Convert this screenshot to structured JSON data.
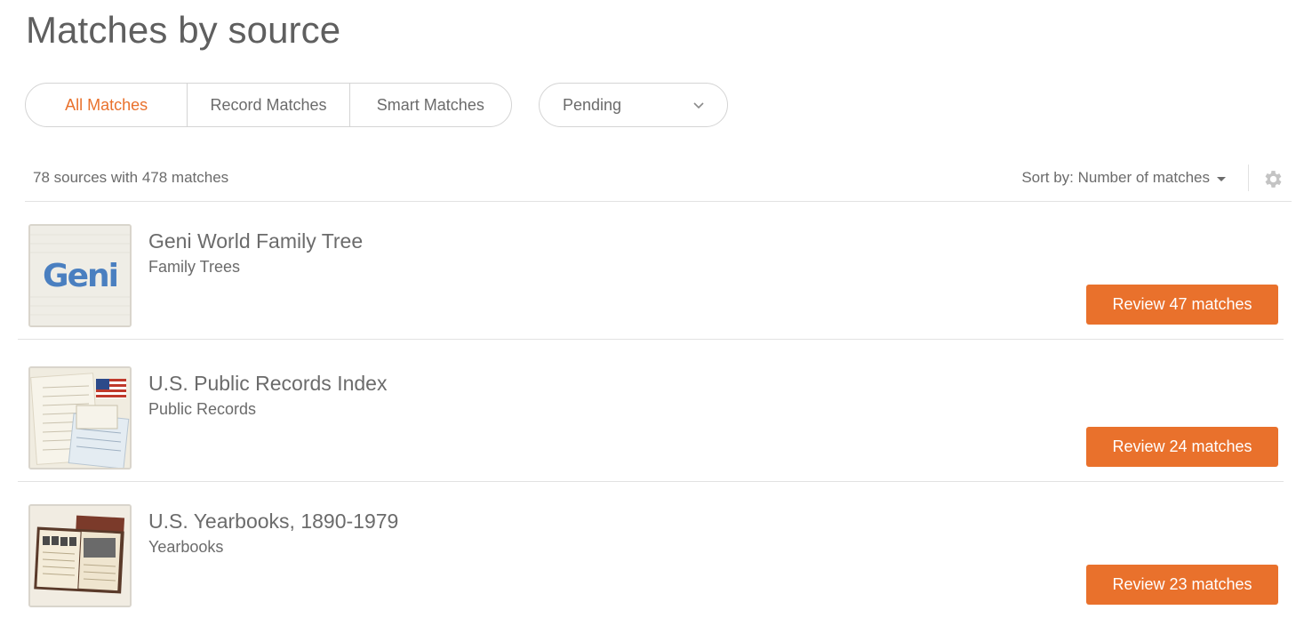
{
  "page_title": "Matches by source",
  "filters": {
    "tabs": [
      {
        "label": "All Matches",
        "active": true
      },
      {
        "label": "Record Matches",
        "active": false
      },
      {
        "label": "Smart Matches",
        "active": false
      }
    ],
    "status": "Pending"
  },
  "summary": "78 sources with 478 matches",
  "sort": {
    "label": "Sort by:",
    "value": "Number of matches"
  },
  "icons": {
    "settings": "gear-icon",
    "status_dropdown": "chevron-down-icon",
    "sort_dropdown": "caret-down-icon"
  },
  "colors": {
    "accent": "#e9712c",
    "text": "#6b6b6b",
    "divider": "#e2e2e2"
  },
  "sources": [
    {
      "title": "Geni World Family Tree",
      "category": "Family Trees",
      "button": "Review 47 matches",
      "logo_text": "Geni"
    },
    {
      "title": "U.S. Public Records Index",
      "category": "Public Records",
      "button": "Review 24 matches"
    },
    {
      "title": "U.S. Yearbooks, 1890-1979",
      "category": "Yearbooks",
      "button": "Review 23 matches"
    }
  ]
}
